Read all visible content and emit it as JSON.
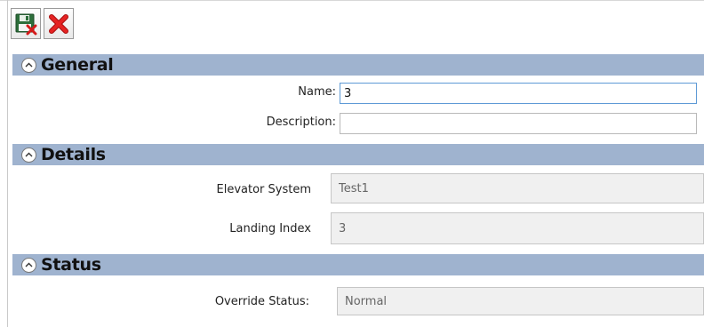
{
  "toolbar": {
    "save_icon": "save-close-icon",
    "cancel_icon": "red-x-icon"
  },
  "sections": {
    "general": {
      "title": "General",
      "name_label": "Name:",
      "name_value": "3",
      "description_label": "Description:",
      "description_value": ""
    },
    "details": {
      "title": "Details",
      "elevator_system_label": "Elevator System",
      "elevator_system_value": "Test1",
      "landing_index_label": "Landing Index",
      "landing_index_value": "3"
    },
    "status": {
      "title": "Status",
      "override_status_label": "Override Status:",
      "override_status_value": "Normal"
    }
  },
  "colors": {
    "section_header": "#9fb3cf",
    "active_input_border": "#5e9ad6"
  }
}
